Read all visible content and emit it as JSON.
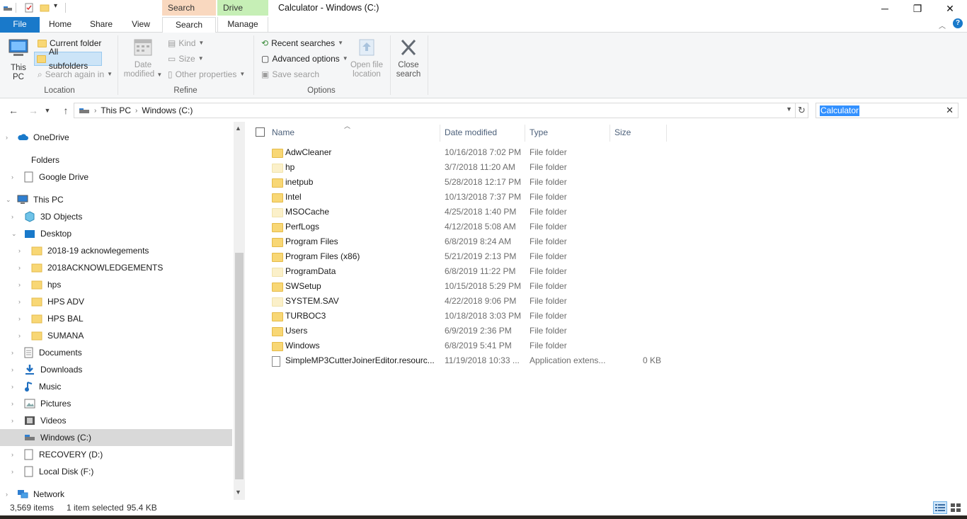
{
  "window": {
    "title": "Calculator - Windows (C:)",
    "context_tabs": [
      "Search Tools",
      "Drive Tools"
    ]
  },
  "ribbon": {
    "tabs": [
      "File",
      "Home",
      "Share",
      "View",
      "Search",
      "Manage"
    ],
    "active_tab": "Search",
    "location": {
      "this_pc_label_1": "This",
      "this_pc_label_2": "PC",
      "current_folder": "Current folder",
      "all_subfolders": "All subfolders",
      "search_again_in": "Search again in",
      "group_label": "Location"
    },
    "refine": {
      "date_modified_1": "Date",
      "date_modified_2": "modified",
      "kind": "Kind",
      "size": "Size",
      "other_properties": "Other properties",
      "group_label": "Refine"
    },
    "options": {
      "recent_searches": "Recent searches",
      "advanced_options": "Advanced options",
      "save_search": "Save search",
      "open_file_location_1": "Open file",
      "open_file_location_2": "location",
      "close_search_1": "Close",
      "close_search_2": "search",
      "group_label": "Options"
    }
  },
  "address": {
    "breadcrumb": [
      "This PC",
      "Windows (C:)"
    ],
    "search_value": "Calculator"
  },
  "nav": {
    "items": [
      {
        "label": "OneDrive",
        "icon": "cloud-icon"
      },
      {
        "label": "Folders",
        "icon": ""
      },
      {
        "label": "Google Drive",
        "icon": "drive-icon"
      },
      {
        "label": "This PC",
        "icon": "pc-icon"
      },
      {
        "label": "3D Objects",
        "icon": "cube-icon"
      },
      {
        "label": "Desktop",
        "icon": "desktop-icon"
      },
      {
        "label": "2018-19 acknowlegements",
        "icon": "folder-icon"
      },
      {
        "label": "2018ACKNOWLEDGEMENTS",
        "icon": "folder-icon"
      },
      {
        "label": "hps",
        "icon": "folder-icon"
      },
      {
        "label": "HPS ADV",
        "icon": "folder-icon"
      },
      {
        "label": "HPS BAL",
        "icon": "folder-icon"
      },
      {
        "label": "SUMANA",
        "icon": "folder-icon"
      },
      {
        "label": "Documents",
        "icon": "documents-icon"
      },
      {
        "label": "Downloads",
        "icon": "download-icon"
      },
      {
        "label": "Music",
        "icon": "music-icon"
      },
      {
        "label": "Pictures",
        "icon": "pictures-icon"
      },
      {
        "label": "Videos",
        "icon": "videos-icon"
      },
      {
        "label": "Windows (C:)",
        "icon": "drive-c-icon"
      },
      {
        "label": "RECOVERY (D:)",
        "icon": "drive-icon"
      },
      {
        "label": "Local Disk (F:)",
        "icon": "drive-icon"
      },
      {
        "label": "Network",
        "icon": "network-icon"
      }
    ]
  },
  "columns": {
    "name": "Name",
    "date": "Date modified",
    "type": "Type",
    "size": "Size"
  },
  "files": [
    {
      "name": "AdwCleaner",
      "date": "10/16/2018 7:02 PM",
      "type": "File folder",
      "size": ""
    },
    {
      "name": "hp",
      "date": "3/7/2018 11:20 AM",
      "type": "File folder",
      "size": ""
    },
    {
      "name": "inetpub",
      "date": "5/28/2018 12:17 PM",
      "type": "File folder",
      "size": ""
    },
    {
      "name": "Intel",
      "date": "10/13/2018 7:37 PM",
      "type": "File folder",
      "size": ""
    },
    {
      "name": "MSOCache",
      "date": "4/25/2018 1:40 PM",
      "type": "File folder",
      "size": ""
    },
    {
      "name": "PerfLogs",
      "date": "4/12/2018 5:08 AM",
      "type": "File folder",
      "size": ""
    },
    {
      "name": "Program Files",
      "date": "6/8/2019 8:24 AM",
      "type": "File folder",
      "size": ""
    },
    {
      "name": "Program Files (x86)",
      "date": "5/21/2019 2:13 PM",
      "type": "File folder",
      "size": ""
    },
    {
      "name": "ProgramData",
      "date": "6/8/2019 11:22 PM",
      "type": "File folder",
      "size": ""
    },
    {
      "name": "SWSetup",
      "date": "10/15/2018 5:29 PM",
      "type": "File folder",
      "size": ""
    },
    {
      "name": "SYSTEM.SAV",
      "date": "4/22/2018 9:06 PM",
      "type": "File folder",
      "size": ""
    },
    {
      "name": "TURBOC3",
      "date": "10/18/2018 3:03 PM",
      "type": "File folder",
      "size": ""
    },
    {
      "name": "Users",
      "date": "6/9/2019 2:36 PM",
      "type": "File folder",
      "size": ""
    },
    {
      "name": "Windows",
      "date": "6/8/2019 5:41 PM",
      "type": "File folder",
      "size": ""
    },
    {
      "name": "SimpleMP3CutterJoinerEditor.resourc...",
      "date": "11/19/2018 10:33 ...",
      "type": "Application extens...",
      "size": "0 KB"
    }
  ],
  "status": {
    "item_count": "3,569 items",
    "selection": "1 item selected",
    "selection_size": "95.4 KB"
  },
  "colors": {
    "accent": "#1979ca",
    "search_tools": "#f9d8bf",
    "drive_tools": "#c6efb6",
    "folder": "#f8d775"
  }
}
